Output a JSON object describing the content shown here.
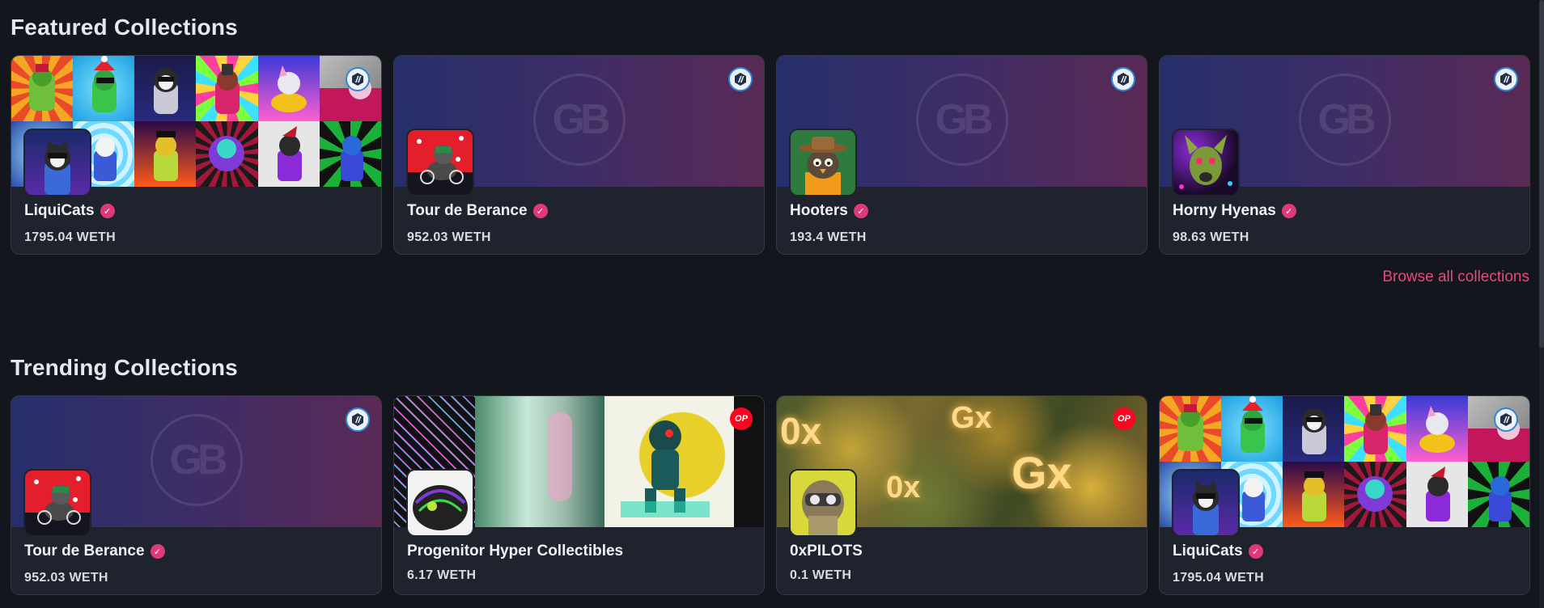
{
  "featured": {
    "title": "Featured Collections",
    "cards": [
      {
        "name": "LiquiCats",
        "price": "1795.04 WETH",
        "verified": true,
        "chain": "arbitrum"
      },
      {
        "name": "Tour de Berance",
        "price": "952.03 WETH",
        "verified": true,
        "chain": "arbitrum"
      },
      {
        "name": "Hooters",
        "price": "193.4 WETH",
        "verified": true,
        "chain": "arbitrum"
      },
      {
        "name": "Horny Hyenas",
        "price": "98.63 WETH",
        "verified": true,
        "chain": "arbitrum"
      }
    ],
    "browse_label": "Browse all collections"
  },
  "trending": {
    "title": "Trending Collections",
    "cards": [
      {
        "name": "Tour de Berance",
        "price": "952.03 WETH",
        "verified": true,
        "chain": "arbitrum"
      },
      {
        "name": "Progenitor Hyper Collectibles",
        "price": "6.17 WETH",
        "verified": false,
        "chain": "optimism",
        "chain_label": "OP"
      },
      {
        "name": "0xPILOTS",
        "price": "0.1 WETH",
        "verified": false,
        "chain": "optimism",
        "chain_label": "OP"
      },
      {
        "name": "LiquiCats",
        "price": "1795.04 WETH",
        "verified": true,
        "chain": "arbitrum"
      }
    ]
  },
  "icons": {
    "verified": "check-badge-icon",
    "arbitrum": "arbitrum-chain-icon",
    "optimism": "optimism-chain-icon"
  },
  "colors": {
    "background": "#13161d",
    "card": "#1f232d",
    "accent": "#e64880",
    "verified": "#e0397b",
    "optimism": "#ff0420"
  }
}
